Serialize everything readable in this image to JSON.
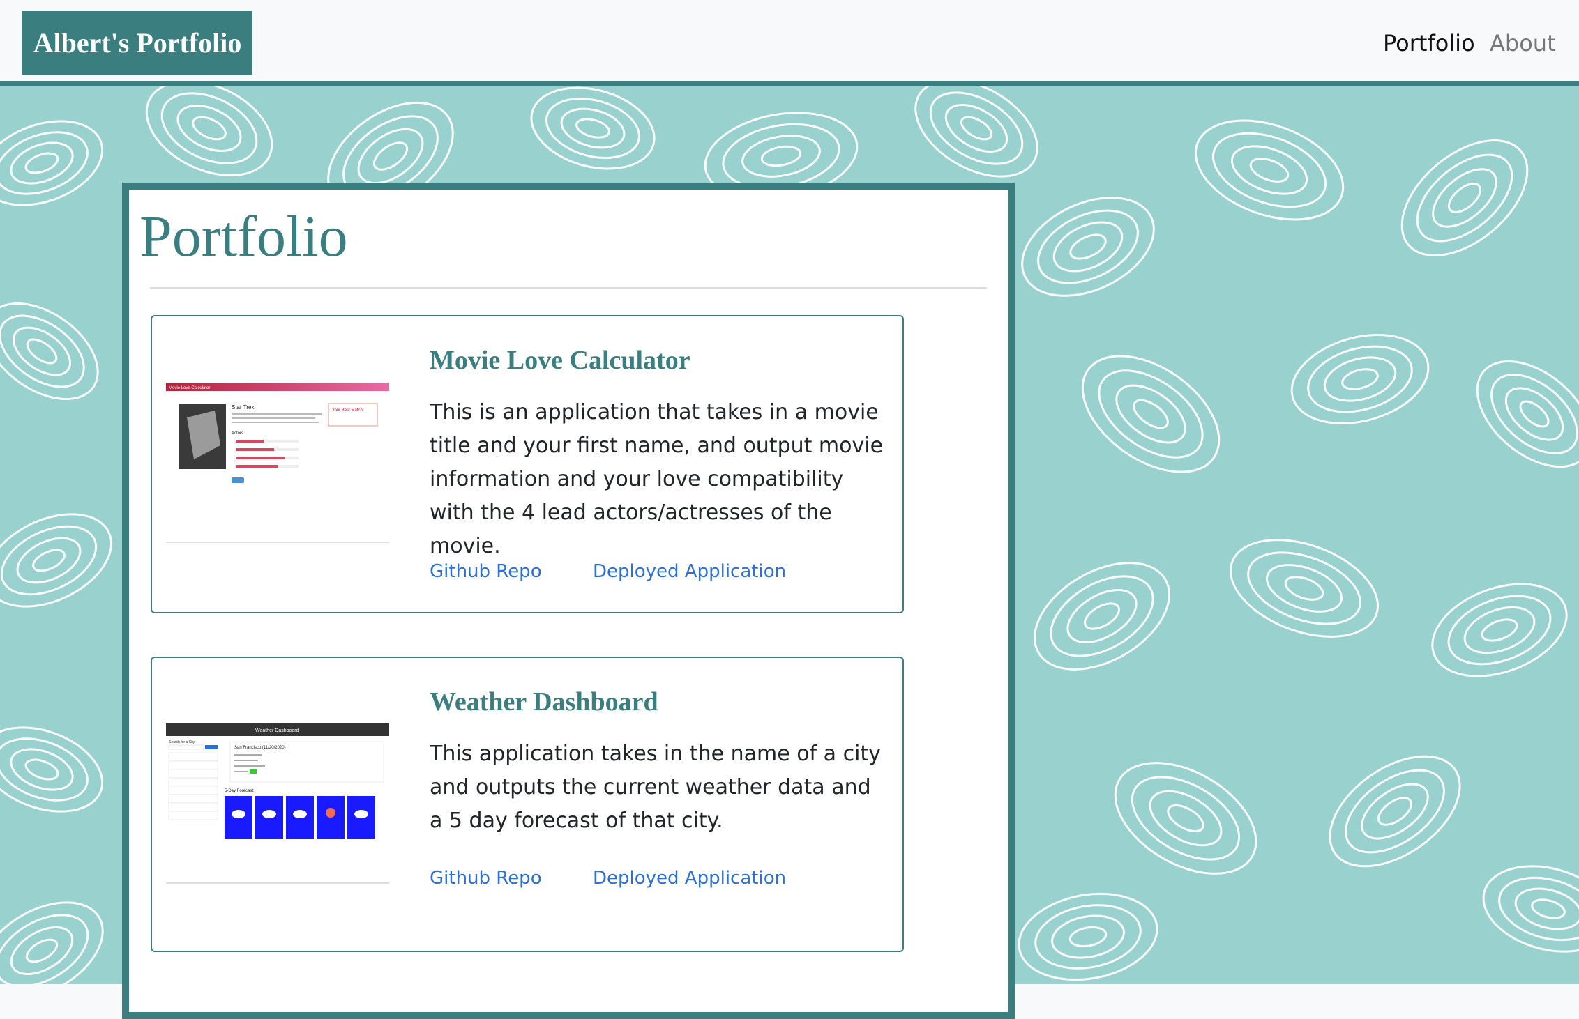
{
  "navbar": {
    "brand": "Albert's Portfolio",
    "links": [
      {
        "label": "Portfolio"
      },
      {
        "label": "About"
      }
    ]
  },
  "page": {
    "title": "Portfolio"
  },
  "projects": [
    {
      "title": "Movie Love Calculator",
      "description": "This is an application that takes in a movie title and your first name, and output movie information and your love compatibility with the 4 lead actors/actresses of the movie.",
      "github_label": "Github Repo",
      "deployed_label": "Deployed Application",
      "thumbnail": {
        "header": "Movie Love Calculator",
        "movie": "Star Trek",
        "match_label": "Your Best Match!",
        "actors_label": "Actors"
      }
    },
    {
      "title": "Weather Dashboard",
      "description": "This application takes in the name of a city and outputs the current weather data and a 5 day forecast of that city.",
      "github_label": "Github Repo",
      "deployed_label": "Deployed Application",
      "thumbnail": {
        "header": "Weather Dashboard",
        "search_label": "Search for a City:",
        "city_line": "San Francisco (11/20/2020)",
        "forecast_label": "5-Day Forecast:"
      }
    }
  ],
  "colors": {
    "accent": "#3a7e80",
    "background_pattern": "#99d1cf",
    "link": "#2a6fdb"
  }
}
